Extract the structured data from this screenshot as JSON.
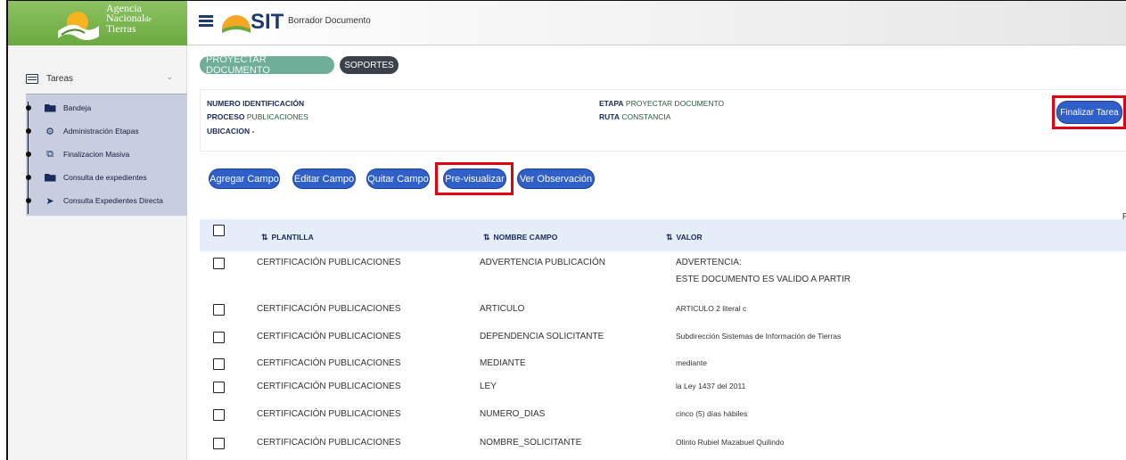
{
  "brand": {
    "line1": "Agencia",
    "line2": "Nacional",
    "line2_suffix": "de",
    "line3": "Tierras"
  },
  "header": {
    "app": "SIT",
    "title": "Borrador Documento"
  },
  "sidebar": {
    "section_label": "Tareas",
    "items": [
      {
        "label": "Bandeja",
        "icon": "folder-open-icon"
      },
      {
        "label": "Administración Etapas",
        "icon": "gear-icon"
      },
      {
        "label": "Finalizacion Masiva",
        "icon": "copy-icon"
      },
      {
        "label": "Consulta de expedientes",
        "icon": "folder-open-icon"
      },
      {
        "label": "Consulta Expedientes Directa",
        "icon": "arrow-right-icon"
      }
    ]
  },
  "chips": {
    "proyectar": "PROYECTAR DOCUMENTO",
    "soportes": "SOPORTES"
  },
  "info": {
    "numero_label": "NUMERO IDENTIFICACIÓN",
    "numero_value": "",
    "proceso_label": "PROCESO",
    "proceso_value": "PUBLICACIONES",
    "ubicacion_label": "UBICACION -",
    "etapa_label": "ETAPA",
    "etapa_value": "PROYECTAR DOCUMENTO",
    "ruta_label": "RUTA",
    "ruta_value": "CONSTANCIA",
    "finalizar": "Finalizar Tarea"
  },
  "actions": {
    "agregar": "Agregar Campo",
    "editar": "Editar Campo",
    "quitar": "Quitar Campo",
    "previsualizar": "Pre-visualizar",
    "observacion": "Ver Observación",
    "edge_char": "F"
  },
  "table": {
    "headers": {
      "plantilla": "PLANTILLA",
      "nombre": "NOMBRE CAMPO",
      "valor": "VALOR"
    },
    "rows": [
      {
        "plantilla": "CERTIFICACIÓN PUBLICACIONES",
        "nombre": "ADVERTENCIA PUBLICACIÓN",
        "valor": "ADVERTENCIA:",
        "valor2": "ESTE DOCUMENTO ES VALIDO A PARTIR"
      },
      {
        "plantilla": "CERTIFICACIÓN PUBLICACIONES",
        "nombre": "ARTICULO",
        "valor": "ARTICULO 2 literal c"
      },
      {
        "plantilla": "CERTIFICACIÓN PUBLICACIONES",
        "nombre": "DEPENDENCIA SOLICITANTE",
        "valor": "Subdirección Sistemas de Información de Tierras"
      },
      {
        "plantilla": "CERTIFICACIÓN PUBLICACIONES",
        "nombre": "MEDIANTE",
        "valor": "mediante"
      },
      {
        "plantilla": "CERTIFICACIÓN PUBLICACIONES",
        "nombre": "LEY",
        "valor": "la Ley 1437 del 2011"
      },
      {
        "plantilla": "CERTIFICACIÓN PUBLICACIONES",
        "nombre": "NUMERO_DIAS",
        "valor": "cinco (5) días hábiles"
      },
      {
        "plantilla": "CERTIFICACIÓN PUBLICACIONES",
        "nombre": "NOMBRE_SOLICITANTE",
        "valor": "Olinto Rubiel Mazabuel Quilindo"
      }
    ]
  },
  "colors": {
    "primary_button": "#2f5fc9",
    "highlight": "#e00012",
    "brand_green": "#6aaa3f",
    "menu_bg": "#c7cee0"
  }
}
